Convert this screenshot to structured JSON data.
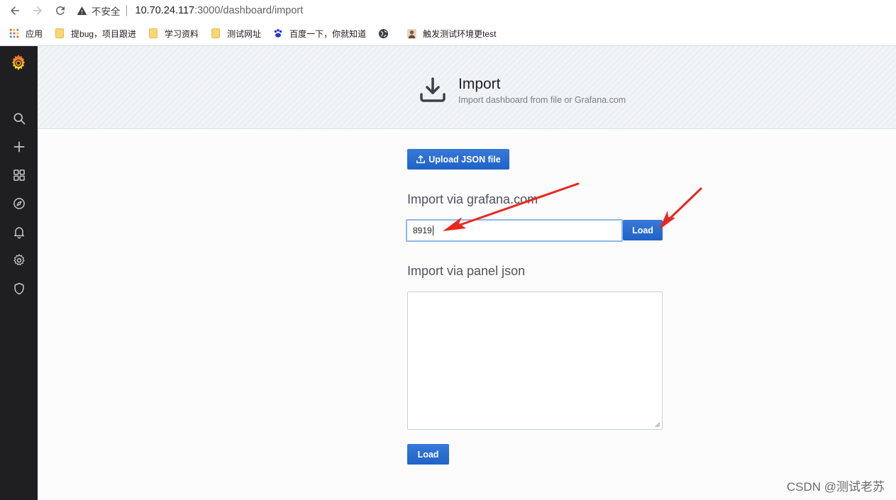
{
  "browser": {
    "security_label": "不安全",
    "url_host": "10.70.24.117",
    "url_path": ":3000/dashboard/import"
  },
  "bookmarks": [
    {
      "label": "应用",
      "icon": "apps-grid-icon"
    },
    {
      "label": "提bug，项目跟进",
      "icon": "folder-icon"
    },
    {
      "label": "学习资料",
      "icon": "folder-icon"
    },
    {
      "label": "测试网址",
      "icon": "folder-icon"
    },
    {
      "label": "百度一下，你就知道",
      "icon": "baidu-paw-icon"
    },
    {
      "label": "",
      "icon": "globe-icon"
    },
    {
      "label": "触发测试环境更test",
      "icon": "avatar-icon"
    }
  ],
  "sidebar": {
    "items": [
      "search-icon",
      "plus-icon",
      "dashboards-icon",
      "explore-compass-icon",
      "alerting-bell-icon",
      "configuration-gear-icon",
      "server-admin-shield-icon"
    ]
  },
  "header": {
    "title": "Import",
    "subtitle": "Import dashboard from file or Grafana.com"
  },
  "main": {
    "upload_label": "Upload JSON file",
    "gcom_title": "Import via grafana.com",
    "gcom_value": "8919",
    "gcom_load_label": "Load",
    "panel_title": "Import via panel json",
    "panel_value": "",
    "panel_load_label": "Load"
  },
  "watermark": "CSDN @测试老苏",
  "colors": {
    "primary": "#1f62c7",
    "sidebar": "#1f1f22",
    "arrow": "#e8281e"
  }
}
